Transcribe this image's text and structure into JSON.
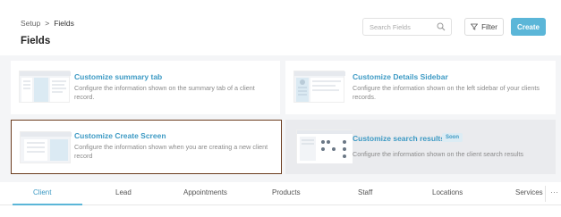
{
  "header": {
    "breadcrumb": {
      "parent": "Setup",
      "separator": ">",
      "current": "Fields"
    },
    "title": "Fields",
    "search": {
      "placeholder": "Search Fields",
      "value": ""
    },
    "filter_label": "Filter",
    "create_label": "Create"
  },
  "cards": [
    {
      "title": "Customize summary tab",
      "description": "Configure the information shown on the summary tab of a client record.",
      "selected": false,
      "badge": ""
    },
    {
      "title": "Customize Details Sidebar",
      "description": "Configure the information shown on the left sidebar of your clients records.",
      "selected": false,
      "badge": ""
    },
    {
      "title": "Customize Create Screen",
      "description": "Configure the information shown when you are creating a new client record",
      "selected": true,
      "badge": ""
    },
    {
      "title": "Customize search results",
      "description": "Configure the information shown on the client search results",
      "selected": false,
      "badge": "Soon"
    }
  ],
  "tabs": [
    {
      "label": "Client",
      "active": true
    },
    {
      "label": "Lead",
      "active": false
    },
    {
      "label": "Appointments",
      "active": false
    },
    {
      "label": "Products",
      "active": false
    },
    {
      "label": "Staff",
      "active": false
    },
    {
      "label": "Locations",
      "active": false
    },
    {
      "label": "Services",
      "active": false
    }
  ],
  "more_label": "···",
  "colors": {
    "accent": "#5bb6d8",
    "link": "#3d9ac4",
    "selected_border": "#6b3b1d",
    "background": "#f4f5f7"
  },
  "icons": {
    "search": "search-icon",
    "filter": "filter-icon",
    "more": "more-icon"
  }
}
